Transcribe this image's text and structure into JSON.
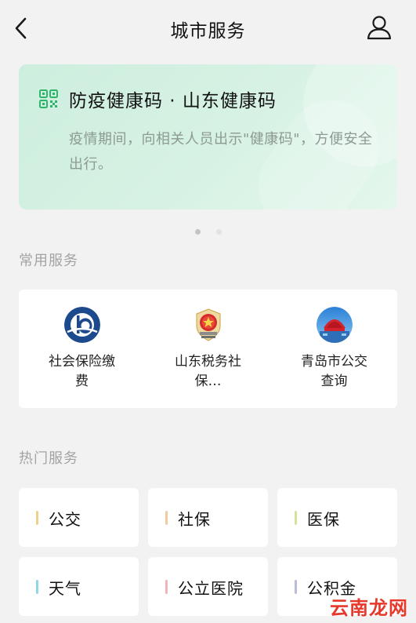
{
  "header": {
    "title": "城市服务",
    "back_icon": "chevron-left-icon",
    "profile_icon": "user-icon"
  },
  "banner": {
    "icon": "qr-code-icon",
    "title": "防疫健康码 · 山东健康码",
    "description": "疫情期间，向相关人员出示\"健康码\"，方便安全出行。",
    "accent": "#2fb56a",
    "background": "#d3f0e0",
    "carousel": {
      "total": 2,
      "active": 1
    }
  },
  "common_services": {
    "label": "常用服务",
    "items": [
      {
        "label": "社会保险缴费",
        "icon": "social-insurance-icon"
      },
      {
        "label": "山东税务社保…",
        "icon": "tax-emblem-icon"
      },
      {
        "label": "青岛市公交查询",
        "icon": "qingdao-bus-icon"
      }
    ]
  },
  "hot_services": {
    "label": "热门服务",
    "items": [
      {
        "label": "公交",
        "color": "#f0d08a"
      },
      {
        "label": "社保",
        "color": "#f3c9a0"
      },
      {
        "label": "医保",
        "color": "#d6e29a"
      },
      {
        "label": "天气",
        "color": "#8fd8e6"
      },
      {
        "label": "公立医院",
        "color": "#f2b3b8"
      },
      {
        "label": "公积金",
        "color": "#b9bcd6"
      }
    ]
  },
  "watermark": "云南龙网"
}
